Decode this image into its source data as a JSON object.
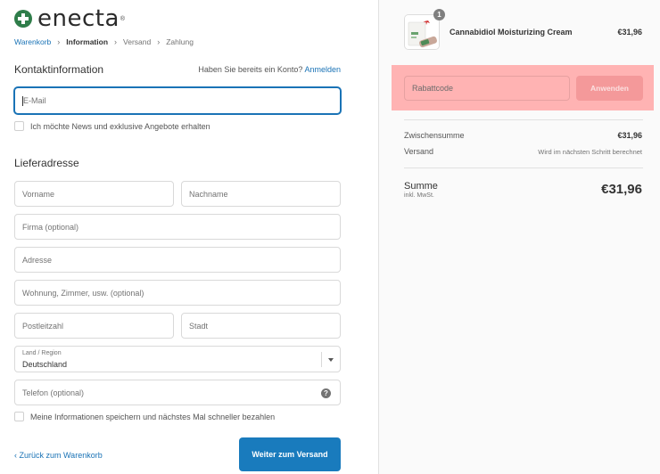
{
  "brand": {
    "name": "enecta",
    "reg": "®",
    "color": "#2f7d4a"
  },
  "breadcrumb": [
    {
      "label": "Warenkorb"
    },
    {
      "label": "Information"
    },
    {
      "label": "Versand"
    },
    {
      "label": "Zahlung"
    }
  ],
  "contact": {
    "heading": "Kontaktinformation",
    "have_account": "Haben Sie bereits ein Konto?",
    "login_link": "Anmelden",
    "email_placeholder": "E-Mail",
    "newsletter_label": "Ich möchte News und exklusive Angebote erhalten"
  },
  "shipping": {
    "heading": "Lieferadresse",
    "first_name": "Vorname",
    "last_name": "Nachname",
    "company": "Firma (optional)",
    "address": "Adresse",
    "apartment": "Wohnung, Zimmer, usw. (optional)",
    "postal": "Postleitzahl",
    "city": "Stadt",
    "country_label": "Land / Region",
    "country_value": "Deutschland",
    "phone": "Telefon (optional)",
    "save_info_label": "Meine Informationen speichern und nächstes Mal schneller bezahlen"
  },
  "actions": {
    "back_label": "Zurück zum Warenkorb",
    "continue_label": "Weiter zum Versand",
    "accent": "#197bbd"
  },
  "order": {
    "item_qty": "1",
    "item_name": "Cannabidiol Moisturizing Cream",
    "item_price": "€31,96",
    "discount_placeholder": "Rabattcode",
    "apply_label": "Anwenden",
    "subtotal_label": "Zwischensumme",
    "subtotal_value": "€31,96",
    "shipping_label": "Versand",
    "shipping_value": "Wird im nächsten Schritt berechnet",
    "total_label": "Summe",
    "total_sub": "inkl. MwSt.",
    "total_value": "€31,96"
  },
  "icons": {
    "logo": "cross-icon",
    "chevron": "chevron-right-icon",
    "select_arrow": "caret-down-icon",
    "help": "question-icon",
    "back": "chevron-left-icon"
  }
}
